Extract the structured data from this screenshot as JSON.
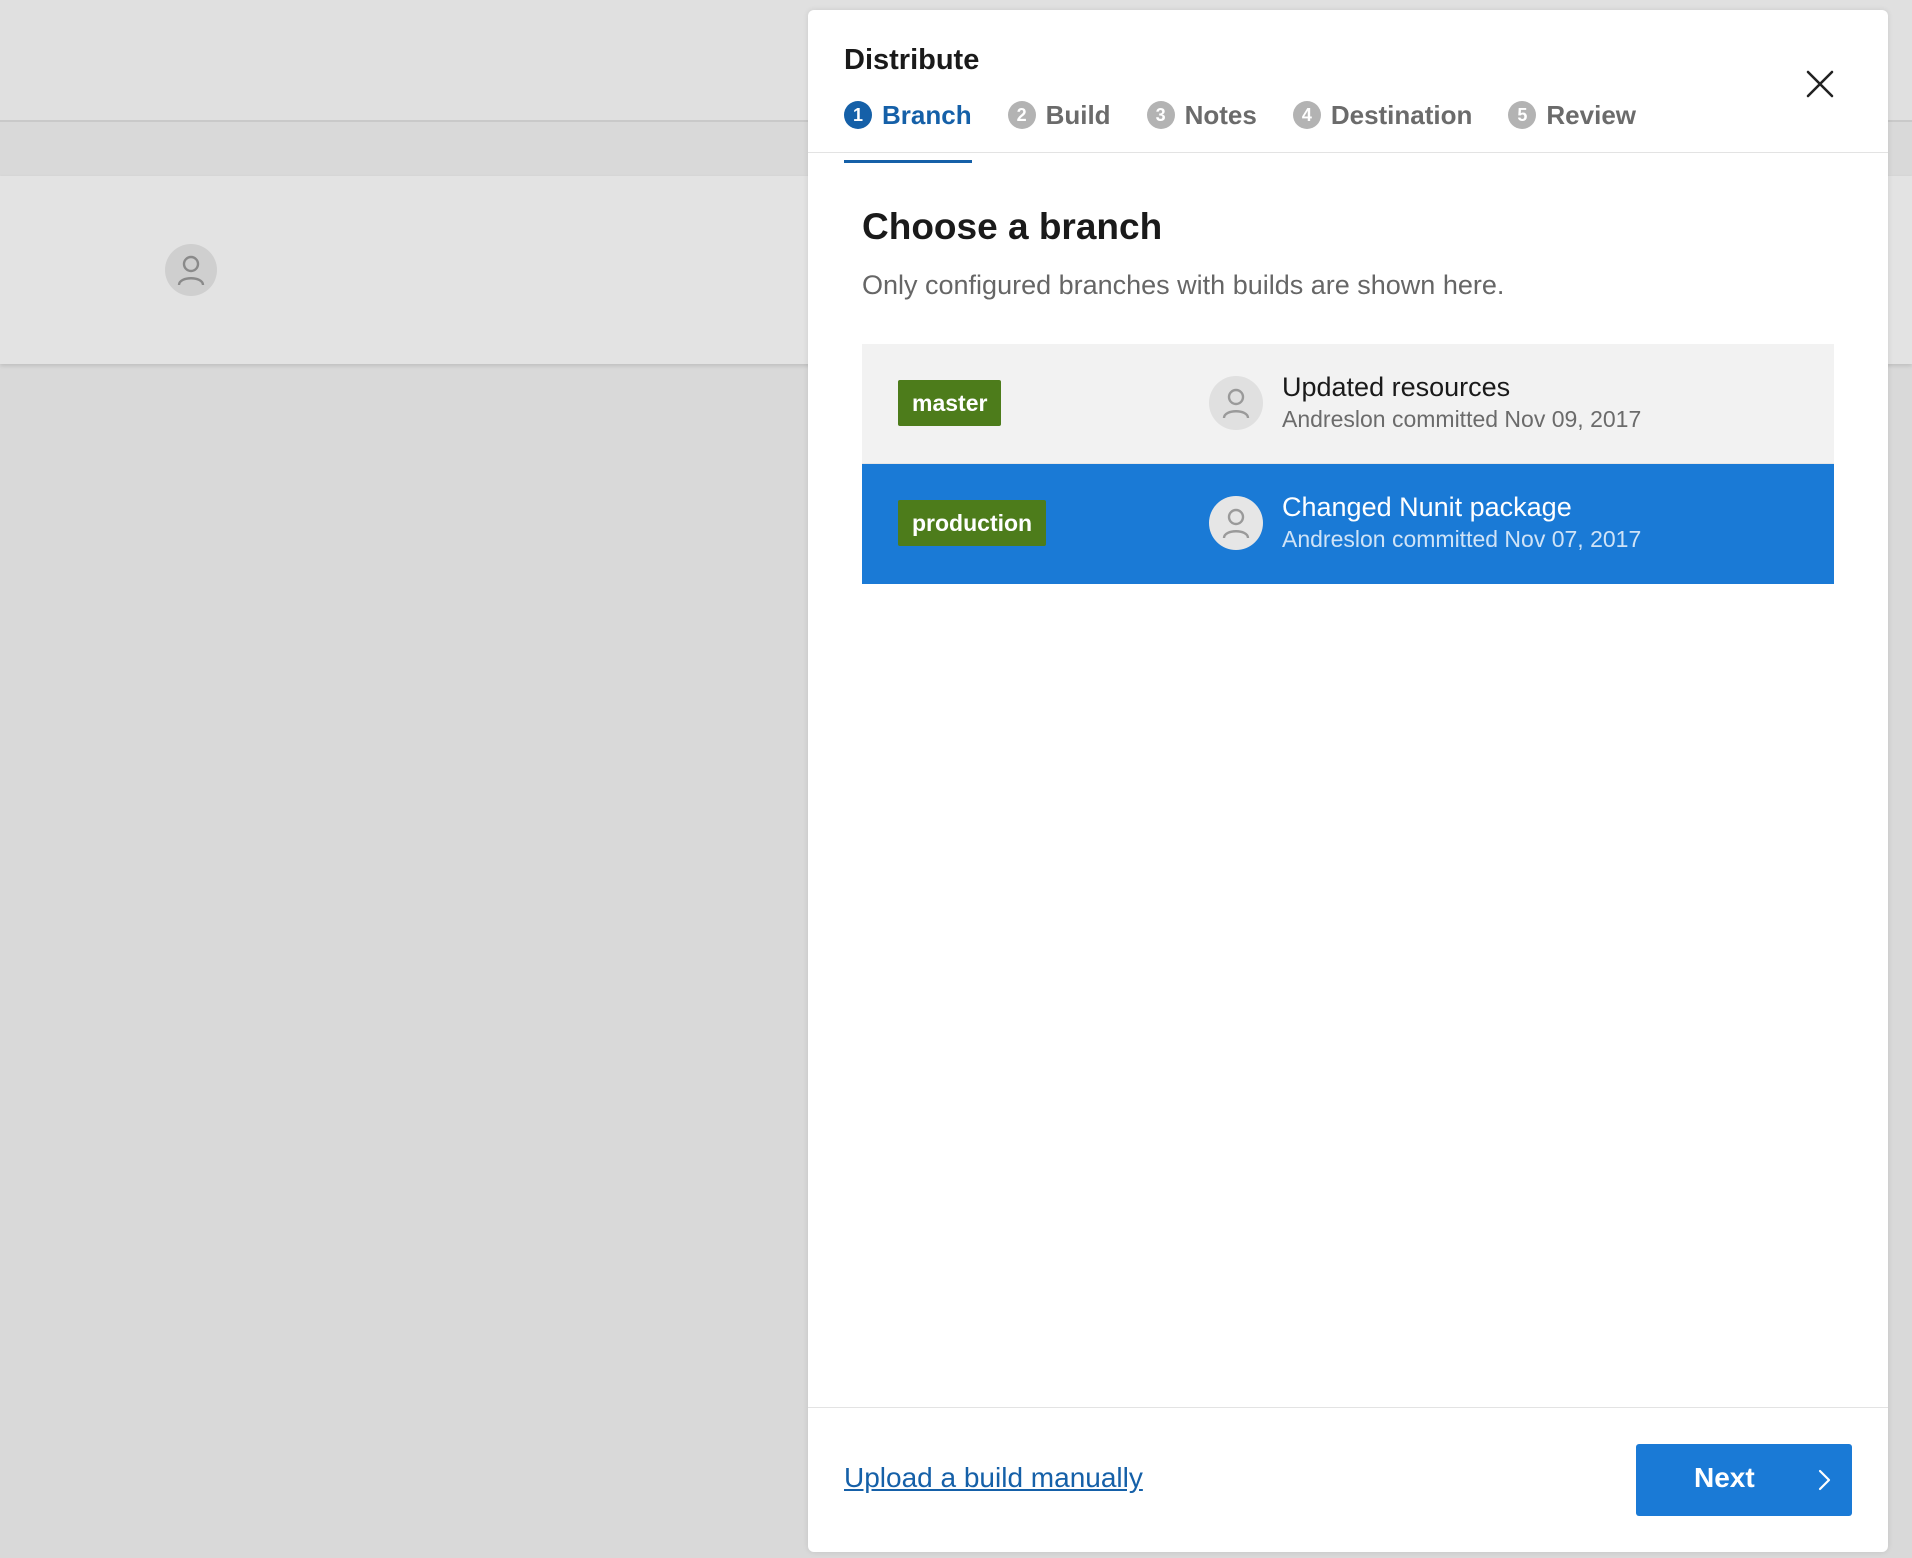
{
  "dialog": {
    "title": "Distribute",
    "steps": [
      {
        "number": "1",
        "label": "Branch",
        "active": true
      },
      {
        "number": "2",
        "label": "Build",
        "active": false
      },
      {
        "number": "3",
        "label": "Notes",
        "active": false
      },
      {
        "number": "4",
        "label": "Destination",
        "active": false
      },
      {
        "number": "5",
        "label": "Review",
        "active": false
      }
    ],
    "close_icon": "close-icon"
  },
  "content": {
    "heading": "Choose a branch",
    "subheading": "Only configured branches with builds are shown here."
  },
  "branches": [
    {
      "name": "master",
      "commit_message": "Updated resources",
      "commit_meta": "Andreslon committed Nov 09, 2017",
      "selected": false
    },
    {
      "name": "production",
      "commit_message": "Changed Nunit package",
      "commit_meta": "Andreslon committed Nov 07, 2017",
      "selected": true
    }
  ],
  "footer": {
    "upload_link": "Upload a build manually",
    "next_label": "Next",
    "next_icon": "chevron-right-icon"
  },
  "colors": {
    "accent": "#1560a8",
    "selected_row": "#1a7ad6",
    "branch_tag": "#4d7c1b"
  }
}
